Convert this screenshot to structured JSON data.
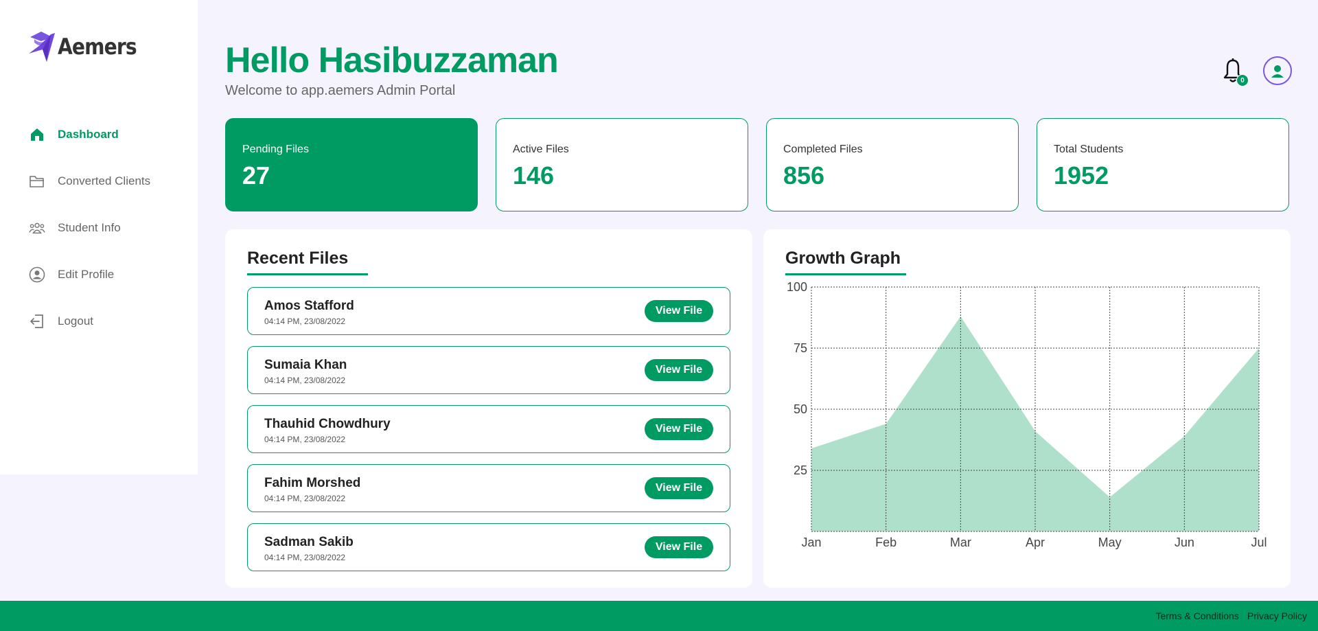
{
  "brand": {
    "name": "Aemers",
    "accent": "#009b63",
    "logo_color": "#7a55e0"
  },
  "sidebar": {
    "items": [
      {
        "label": "Dashboard",
        "icon": "home-icon",
        "active": true
      },
      {
        "label": "Converted Clients",
        "icon": "folder-icon",
        "active": false
      },
      {
        "label": "Student Info",
        "icon": "users-icon",
        "active": false
      },
      {
        "label": "Edit Profile",
        "icon": "user-circle-icon",
        "active": false
      },
      {
        "label": "Logout",
        "icon": "logout-icon",
        "active": false
      }
    ]
  },
  "header": {
    "greeting": "Hello Hasibuzzaman",
    "subtitle": "Welcome to app.aemers Admin Portal",
    "notification_count": "0"
  },
  "stats": [
    {
      "label": "Pending Files",
      "value": "27"
    },
    {
      "label": "Active Files",
      "value": "146"
    },
    {
      "label": "Completed Files",
      "value": "856"
    },
    {
      "label": "Total Students",
      "value": "1952"
    }
  ],
  "recent_files": {
    "title": "Recent Files",
    "button_label": "View File",
    "items": [
      {
        "name": "Amos Stafford",
        "time": "04:14 PM, 23/08/2022"
      },
      {
        "name": "Sumaia Khan",
        "time": "04:14 PM, 23/08/2022"
      },
      {
        "name": "Thauhid Chowdhury",
        "time": "04:14 PM, 23/08/2022"
      },
      {
        "name": "Fahim Morshed",
        "time": "04:14 PM, 23/08/2022"
      },
      {
        "name": "Sadman Sakib",
        "time": "04:14 PM, 23/08/2022"
      }
    ]
  },
  "growth": {
    "title": "Growth Graph"
  },
  "chart_data": {
    "type": "area",
    "title": "Growth Graph",
    "categories": [
      "Jan",
      "Feb",
      "Mar",
      "Apr",
      "May",
      "Jun",
      "Jul"
    ],
    "values": [
      34,
      44,
      88,
      41,
      14,
      39,
      75
    ],
    "ylim": [
      0,
      100
    ],
    "yticks": [
      25,
      50,
      75,
      100
    ],
    "grid": true,
    "grid_style": "dotted",
    "fill_color": "#aee0cb"
  },
  "footer": {
    "links": [
      "Terms & Conditions",
      "Privacy Policy"
    ]
  }
}
